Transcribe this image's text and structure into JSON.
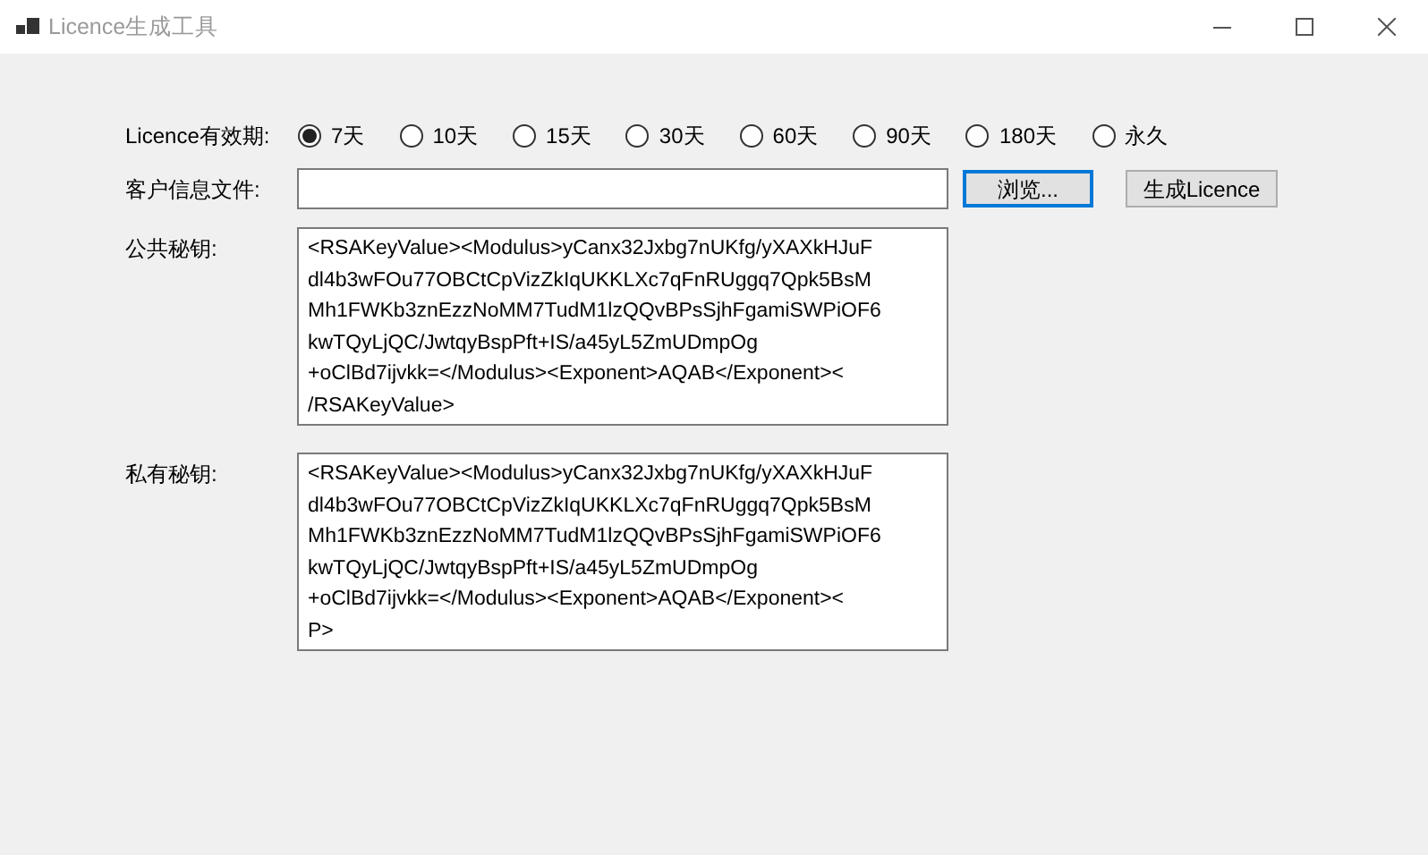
{
  "window": {
    "title": "Licence生成工具"
  },
  "validity": {
    "label": "Licence有效期:",
    "options": [
      {
        "label": "7天",
        "selected": true
      },
      {
        "label": "10天",
        "selected": false
      },
      {
        "label": "15天",
        "selected": false
      },
      {
        "label": "30天",
        "selected": false
      },
      {
        "label": "60天",
        "selected": false
      },
      {
        "label": "90天",
        "selected": false
      },
      {
        "label": "180天",
        "selected": false
      },
      {
        "label": "永久",
        "selected": false
      }
    ]
  },
  "customer_file": {
    "label": "客户信息文件:"
  },
  "buttons": [
    {
      "label": "浏览...",
      "focused": true
    },
    {
      "label": "生成Licence",
      "focused": false
    }
  ],
  "public_key": {
    "label": "公共秘钥:",
    "lines": [
      "<RSAKeyValue><Modulus>yCanx32Jxbg7nUKfg/yXAXkHJuF",
      "dl4b3wFOu77OBCtCpVizZkIqUKKLXc7qFnRUggq7Qpk5BsM",
      "Mh1FWKb3znEzzNoMM7TudM1lzQQvBPsSjhFgamiSWPiOF6",
      "kwTQyLjQC/JwtqyBspPft+IS/a45yL5ZmUDmpOg",
      "+oClBd7ijvkk=</Modulus><Exponent>AQAB</Exponent><",
      "/RSAKeyValue>"
    ]
  },
  "private_key": {
    "label": "私有秘钥:",
    "lines": [
      "<RSAKeyValue><Modulus>yCanx32Jxbg7nUKfg/yXAXkHJuF",
      "dl4b3wFOu77OBCtCpVizZkIqUKKLXc7qFnRUggq7Qpk5BsM",
      "Mh1FWKb3znEzzNoMM7TudM1lzQQvBPsSjhFgamiSWPiOF6",
      "kwTQyLjQC/JwtqyBspPft+IS/a45yL5ZmUDmpOg",
      "+oClBd7ijvkk=</Modulus><Exponent>AQAB</Exponent><",
      "P>"
    ]
  }
}
